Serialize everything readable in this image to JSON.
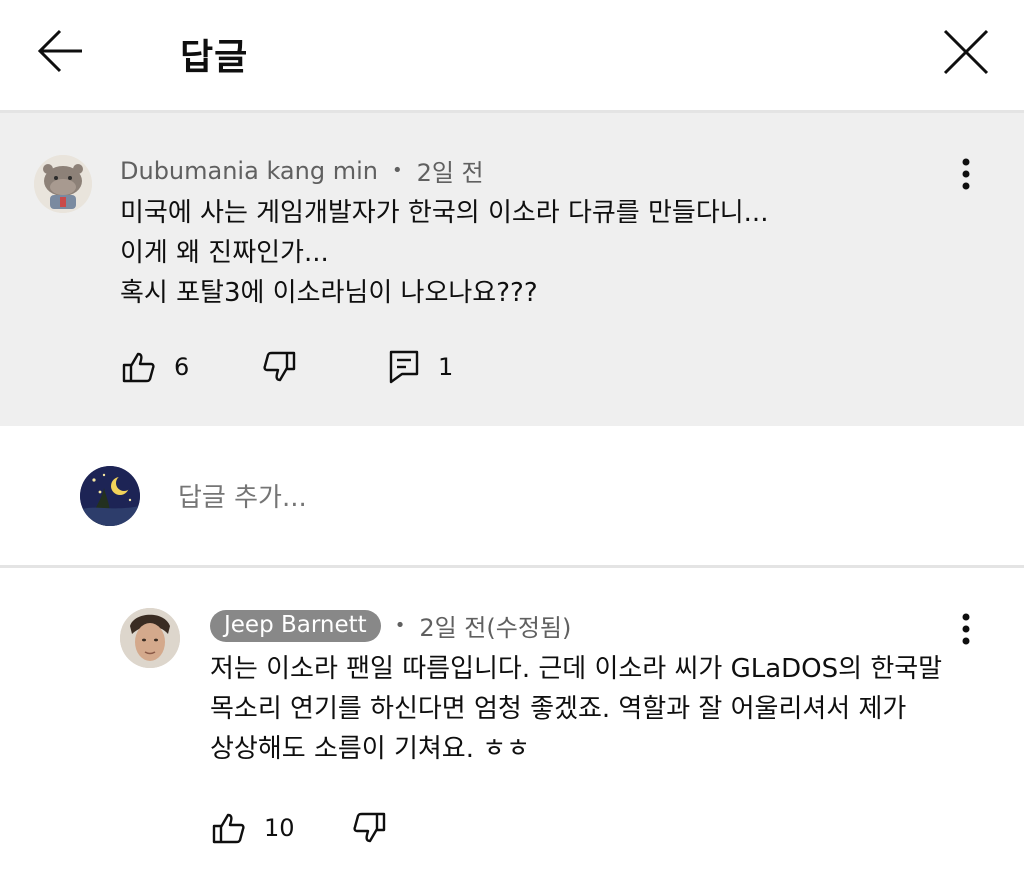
{
  "header": {
    "title": "답글"
  },
  "parent_comment": {
    "author": "Dubumania kang min",
    "time": "2일 전",
    "lines": [
      "미국에 사는 게임개발자가 한국의 이소라 다큐를 만들다니...",
      "이게 왜 진짜인가...",
      "혹시 포탈3에 이소라님이 나오나요???"
    ],
    "likes": "6",
    "replies": "1"
  },
  "reply_box": {
    "placeholder": "답글 추가..."
  },
  "reply": {
    "author": "Jeep Barnett",
    "time": "2일 전(수정됨)",
    "lines": [
      "저는 이소라 팬일 따름입니다. 근데 이소라 씨가 GLaDOS의 한국말",
      "목소리 연기를 하신다면 엄청 좋겠죠. 역할과 잘 어울리셔서 제가",
      "상상해도 소름이 기쳐요. ㅎㅎ"
    ],
    "likes": "10"
  },
  "icons": {
    "back": "arrow-left-icon",
    "close": "close-icon",
    "menu": "more-vertical-icon",
    "like": "thumbs-up-icon",
    "dislike": "thumbs-down-icon",
    "reply": "comment-icon"
  },
  "colors": {
    "parent_background": "#efefef",
    "secondary_text": "#606060",
    "badge_background": "#888888"
  }
}
